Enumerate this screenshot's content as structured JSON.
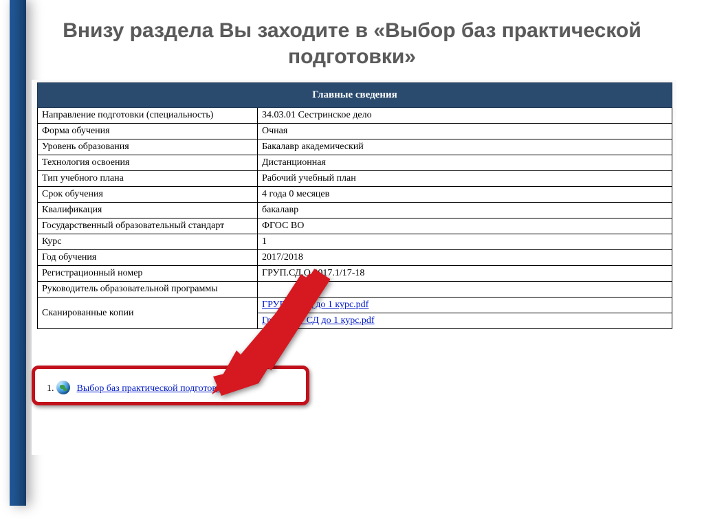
{
  "title": "Внизу раздела Вы заходите в «Выбор баз практической подготовки»",
  "table": {
    "header": "Главные сведения",
    "rows": [
      {
        "label": "Направление подготовки (специальность)",
        "value": "34.03.01 Сестринское дело"
      },
      {
        "label": "Форма обучения",
        "value": "Очная"
      },
      {
        "label": "Уровень образования",
        "value": "Бакалавр академический"
      },
      {
        "label": "Технология освоения",
        "value": "Дистанционная"
      },
      {
        "label": "Тип учебного плана",
        "value": "Рабочий учебный план"
      },
      {
        "label": "Срок обучения",
        "value": "4 года 0 месяцев"
      },
      {
        "label": "Квалификация",
        "value": "бакалавр"
      },
      {
        "label": "Государственный образовательный стандарт",
        "value": "ФГОС ВО"
      },
      {
        "label": "Курс",
        "value": "1"
      },
      {
        "label": "Год обучения",
        "value": "2017/2018"
      },
      {
        "label": "Регистрационный номер",
        "value": "ГРУП.СД.О.2017.1/17-18"
      },
      {
        "label": "Руководитель образовательной программы",
        "value": ""
      }
    ],
    "scans_label": "Сканированные копии",
    "scan_files": [
      "ГРУП 17 СД до 1 курс.pdf",
      "График 17 СД до 1 курс.pdf"
    ]
  },
  "nav_link": "Выбор баз практической подготовки",
  "colors": {
    "header_bg": "#2a4a6e",
    "link": "#0019c9",
    "highlight": "#c1111b",
    "stripe": "#1d4f88"
  }
}
